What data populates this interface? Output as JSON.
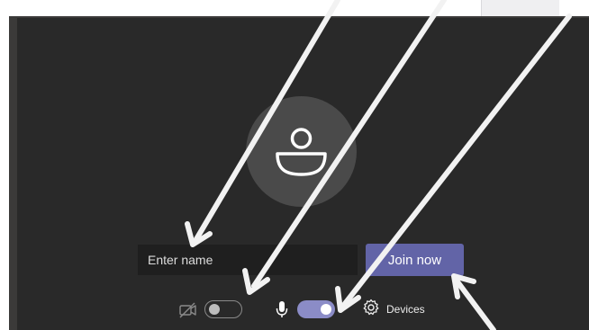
{
  "join_screen": {
    "name_input": {
      "placeholder": "Enter name",
      "value": ""
    },
    "join_button": {
      "label": "Join now",
      "color": "#6264a7"
    },
    "camera": {
      "enabled": false
    },
    "microphone": {
      "enabled": true,
      "toggle_color": "#8b8cc7"
    },
    "devices_label": "Devices"
  },
  "icons": {
    "avatar": "person-icon",
    "camera": "camera-off-icon",
    "microphone": "microphone-icon",
    "devices": "gear-icon",
    "annotations": "arrow-icon"
  },
  "colors": {
    "stage_background": "#292929",
    "frame": "#3b3a39",
    "avatar_circle": "#4a4a4a",
    "input_background": "#1f1f1f"
  }
}
